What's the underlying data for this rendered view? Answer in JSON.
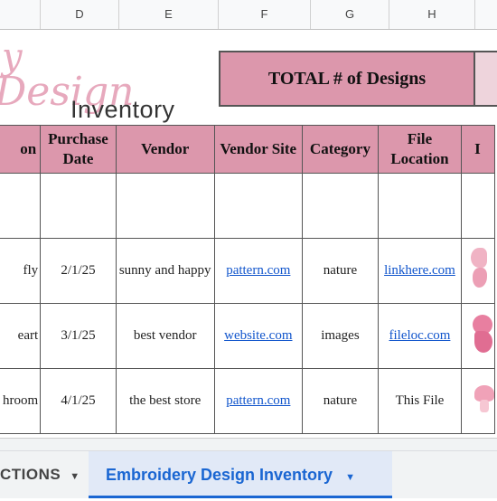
{
  "column_headers": [
    "D",
    "E",
    "F",
    "G",
    "H"
  ],
  "logo": {
    "script_line1": "y",
    "script_line2": "Design",
    "word": "Inventory"
  },
  "total_label": "TOTAL # of Designs",
  "table": {
    "headers": [
      "on",
      "Purchase Date",
      "Vendor",
      "Vendor Site",
      "Category",
      "File Location",
      "I"
    ],
    "rows": [
      [
        "fly",
        "2/1/25",
        "sunny and happy",
        "pattern.com",
        "nature",
        "linkhere.com"
      ],
      [
        "eart",
        "3/1/25",
        "best vendor",
        "website.com",
        "images",
        "fileloc.com"
      ],
      [
        "hroom",
        "4/1/25",
        "the best store",
        "pattern.com",
        "nature",
        "This File"
      ]
    ]
  },
  "tabs": {
    "tab1_label": "CTIONS",
    "tab2_label": "Embroidery Design Inventory"
  },
  "colors": {
    "header_pink": "#dc97ac",
    "active_tab_blue": "#1a66d2"
  }
}
